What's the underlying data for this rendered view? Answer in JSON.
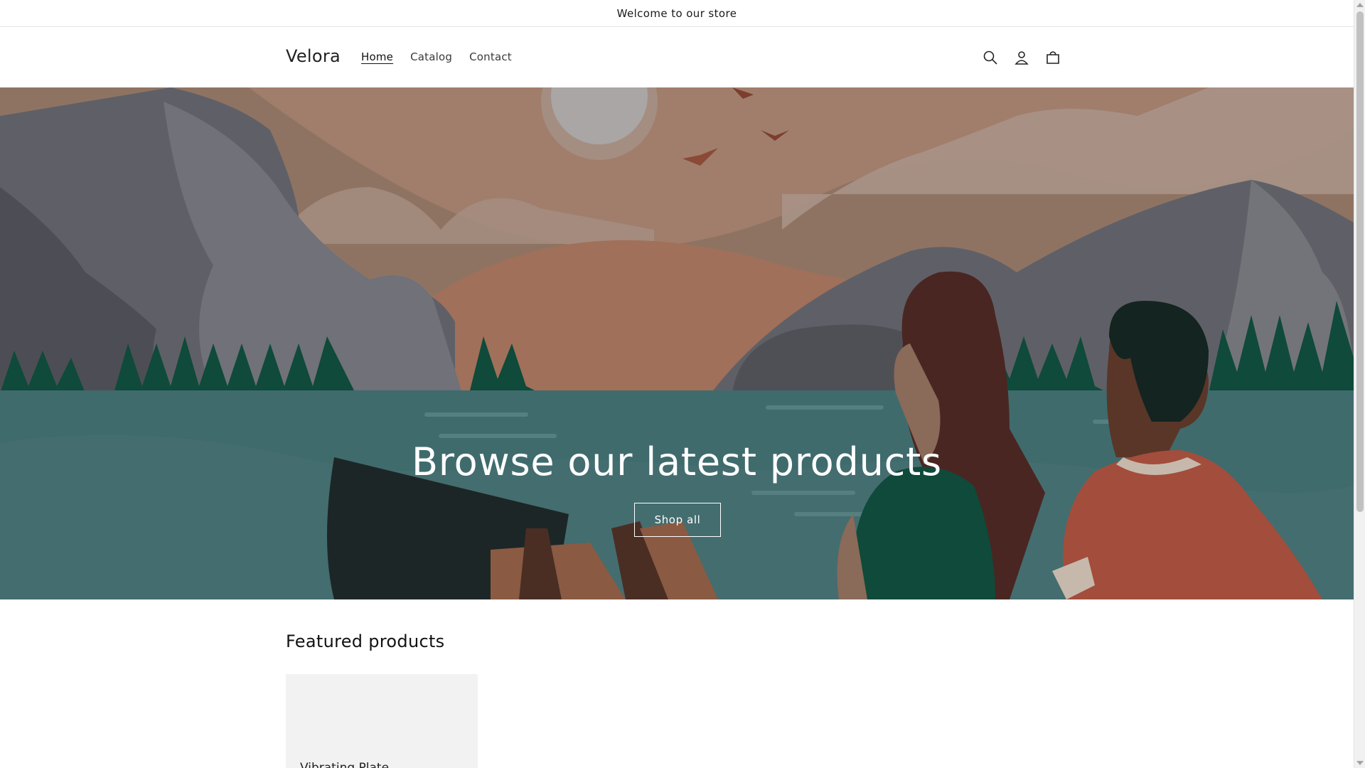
{
  "announcement": {
    "text": "Welcome to our store"
  },
  "header": {
    "logo": "Velora",
    "nav": [
      {
        "label": "Home",
        "active": true
      },
      {
        "label": "Catalog",
        "active": false
      },
      {
        "label": "Contact",
        "active": false
      }
    ],
    "icons": [
      "search-icon",
      "account-icon",
      "cart-icon"
    ]
  },
  "hero": {
    "title": "Browse our latest products",
    "button_label": "Shop all"
  },
  "featured": {
    "title": "Featured products",
    "products": [
      {
        "name": "Vibrating Plate"
      }
    ]
  },
  "colors": {
    "sky": "#8f7362",
    "lake": "#3f6b6d",
    "forest": "#0f4a3a",
    "mountain": "#5f6067"
  }
}
